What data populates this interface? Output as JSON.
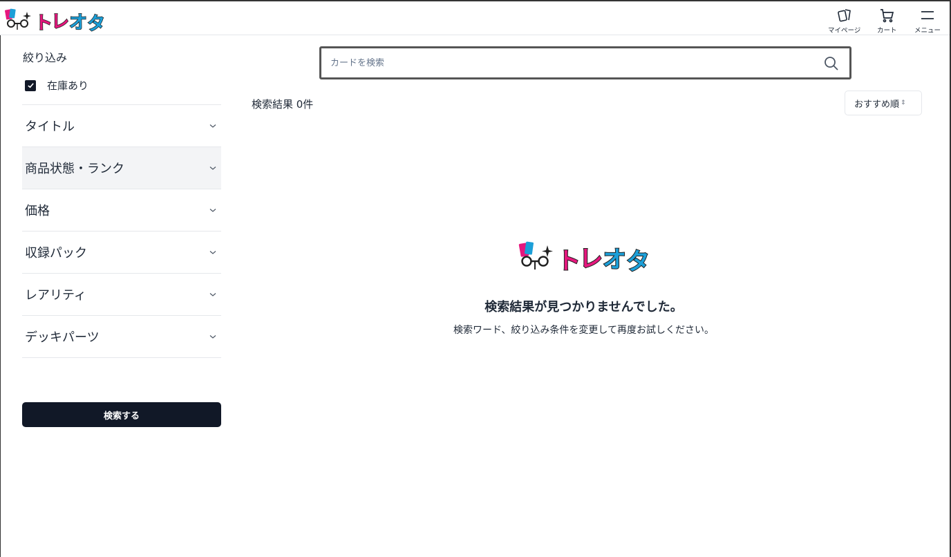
{
  "header": {
    "logo_text": "トレオタ",
    "nav": [
      {
        "label": "マイページ",
        "icon": "cards-icon"
      },
      {
        "label": "カート",
        "icon": "cart-icon"
      },
      {
        "label": "メニュー",
        "icon": "menu-icon"
      }
    ]
  },
  "sidebar": {
    "title": "絞り込み",
    "in_stock_label": "在庫あり",
    "in_stock_checked": true,
    "filters": [
      {
        "label": "タイトル"
      },
      {
        "label": "商品状態・ランク"
      },
      {
        "label": "価格"
      },
      {
        "label": "収録パック"
      },
      {
        "label": "レアリティ"
      },
      {
        "label": "デッキパーツ"
      }
    ],
    "search_button": "検索する"
  },
  "main": {
    "search_placeholder": "カードを検索",
    "result_count": "検索結果 0件",
    "sort_label": "おすすめ順",
    "empty_title": "検索結果が見つかりませんでした。",
    "empty_message": "検索ワード、絞り込み条件を変更して再度お試しください。"
  },
  "colors": {
    "logo_pink": "#e6177e",
    "logo_blue": "#1c9fd8",
    "primary_dark": "#111827"
  }
}
